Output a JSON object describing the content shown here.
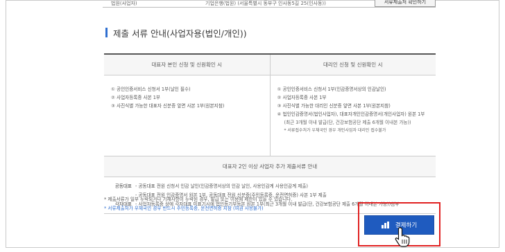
{
  "top": {
    "cells": [
      "법원(사업자)",
      "기업은행(법원) (서울특별시 동부구 인사동5길 25(인사동))"
    ],
    "button_label": "서류제출처 확인하기"
  },
  "section_title": "제출 서류 안내(사업자용(법인/개인))",
  "table": {
    "headers": [
      "대표자 본인 신청 및 신원확인 시",
      "대리인 신청 및 신원확인 시"
    ],
    "left_items": [
      "① 공인인증서비스 신청서 1부(날인 필수)",
      "② 사업자등록증 사본 1부",
      "③ 사진식별 가능한 대표자 신분증 앞면 사본 1부(원본지참)"
    ],
    "right_items": [
      "① 공인인증서비스 신청서 1부(인감증명서상의 인감날인)",
      "② 사업자등록증 사본 1부",
      "③ 사진식별 가능한 대리인 신분증 앞면 사본 1부(원본지참)",
      "④ 법인인감증명서(법인사업자), 대표자개인인감증명서(개인사업자) 원본 1부"
    ],
    "right_sub": [
      "(최근 3개월 이내 발급(단, 건강보험공단 제출 6개월 이내본 가능))",
      "* 서류접수처가 우체국인 경우 개인사업자 대리인 접수불가"
    ],
    "multi_header": "대표자 2인 이상 사업자 추가 제출서류 안내",
    "multi_rows": [
      {
        "label": "공동대표",
        "text": "- 공동대표 전원 신청서 인감 날인(인감증명서상의 인감 날인, 사용인감계 사용인감계 제출)"
      },
      {
        "label": "",
        "text": "- 공동대표 전원 인감증명서 원본 1부, 공동대표 전원 신분증(주민등록증, 운전면허증) 사본 1부 제출"
      },
      {
        "label": "각자대표",
        "text": "- 사업자등록증 상에 각자대표 미표기시에 법인등기부등본 원본 1부(최근 3개월 이내 발급(단, 건강보험공단 제출 6개월 이내본 가능))첨부"
      }
    ]
  },
  "notes": [
    "* 제출서류가 일부 누락되거나 기재사항이 누락된 경우, 발급 또는 이용에 제한이 있을 수 있습니다.",
    "* 서류제출처가 우체국인 경우 반드시 주민등록증, 운전면허증 지참 (여권 사용불가)"
  ],
  "pay_button_label": "결제하기",
  "colors": {
    "accent": "#1f5bbf",
    "highlight": "#e02020",
    "note_blue": "#2f6fd0"
  }
}
